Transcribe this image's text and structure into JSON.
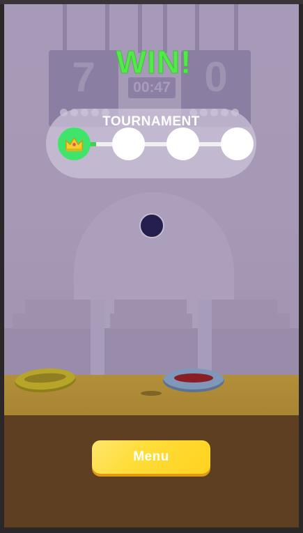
{
  "result": {
    "title": "WIN!"
  },
  "scoreboard": {
    "left_score": "7",
    "right_score": "0",
    "timer": "00:47"
  },
  "tournament": {
    "title": "TOURNAMENT",
    "stages_total": 4,
    "stages_completed": 1,
    "completed_icon": "crown-icon"
  },
  "menu": {
    "button_label": "Menu"
  },
  "colors": {
    "win_text": "#55e84a",
    "progress_green": "#3ee56a",
    "menu_button": "#ffd83a",
    "ball": "#241f4f"
  }
}
